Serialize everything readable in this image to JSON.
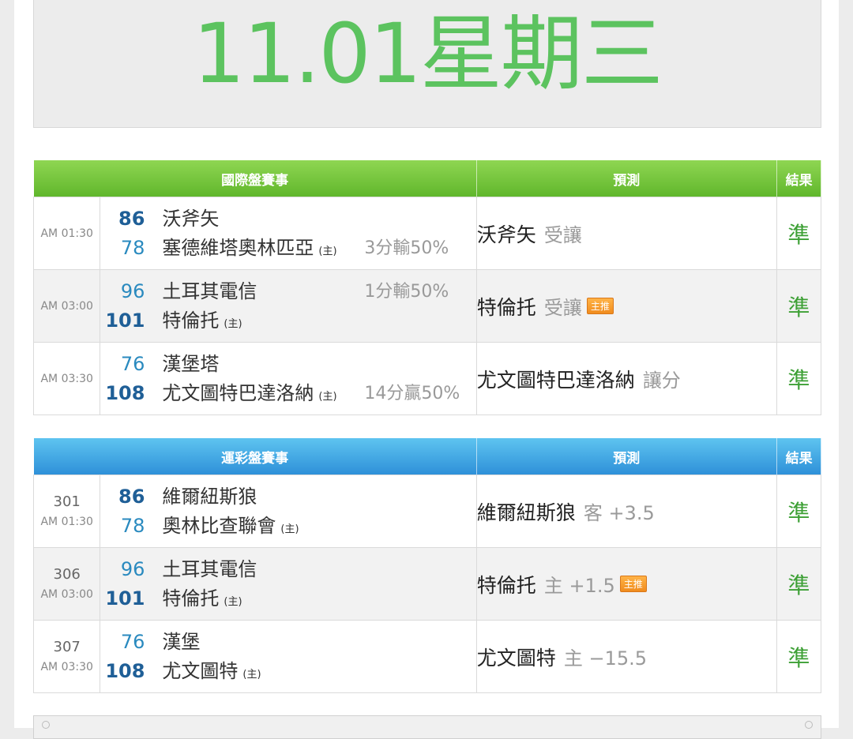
{
  "date": {
    "text": "11.01星期三"
  },
  "international": {
    "headers": {
      "match": "國際盤賽事",
      "prediction": "預測",
      "result": "結果"
    },
    "rows": [
      {
        "time": "AM 01:30",
        "away": {
          "score": "86",
          "name": "沃斧矢"
        },
        "home": {
          "score": "78",
          "name": "塞德維塔奧林匹亞",
          "mark": "(主)"
        },
        "handicap": "3分輸50%",
        "handicap_row": "home",
        "pred_team": "沃斧矢",
        "pred_type": "受讓",
        "badge": "",
        "result": "準"
      },
      {
        "time": "AM 03:00",
        "away": {
          "score": "96",
          "name": "土耳其電信"
        },
        "home": {
          "score": "101",
          "name": "特倫托",
          "mark": "(主)"
        },
        "handicap": "1分輸50%",
        "handicap_row": "away",
        "pred_team": "特倫托",
        "pred_type": "受讓",
        "badge": "主推",
        "result": "準"
      },
      {
        "time": "AM 03:30",
        "away": {
          "score": "76",
          "name": "漢堡塔"
        },
        "home": {
          "score": "108",
          "name": "尤文圖特巴達洛納",
          "mark": "(主)"
        },
        "handicap": "14分贏50%",
        "handicap_row": "home",
        "pred_team": "尤文圖特巴達洛納",
        "pred_type": "讓分",
        "badge": "",
        "result": "準"
      }
    ]
  },
  "sports_lottery": {
    "headers": {
      "match": "運彩盤賽事",
      "prediction": "預測",
      "result": "結果"
    },
    "rows": [
      {
        "num": "301",
        "time": "AM 01:30",
        "away": {
          "score": "86",
          "name": "維爾紐斯狼"
        },
        "home": {
          "score": "78",
          "name": "奧林比查聯會",
          "mark": "(主)"
        },
        "pred_team": "維爾紐斯狼",
        "pred_type": "客 +3.5",
        "badge": "",
        "result": "準"
      },
      {
        "num": "306",
        "time": "AM 03:00",
        "away": {
          "score": "96",
          "name": "土耳其電信"
        },
        "home": {
          "score": "101",
          "name": "特倫托",
          "mark": "(主)"
        },
        "pred_team": "特倫托",
        "pred_type": "主 +1.5",
        "badge": "主推",
        "result": "準"
      },
      {
        "num": "307",
        "time": "AM 03:30",
        "away": {
          "score": "76",
          "name": "漢堡"
        },
        "home": {
          "score": "108",
          "name": "尤文圖特",
          "mark": "(主)"
        },
        "pred_team": "尤文圖特",
        "pred_type": "主 −15.5",
        "badge": "",
        "result": "準"
      }
    ]
  },
  "colors": {
    "date_green": "#5cc35f",
    "intl_header": "#6cbf34",
    "lottery_header": "#3aa2e3",
    "result_green": "#3da035",
    "badge_orange": "#f08c1e"
  }
}
